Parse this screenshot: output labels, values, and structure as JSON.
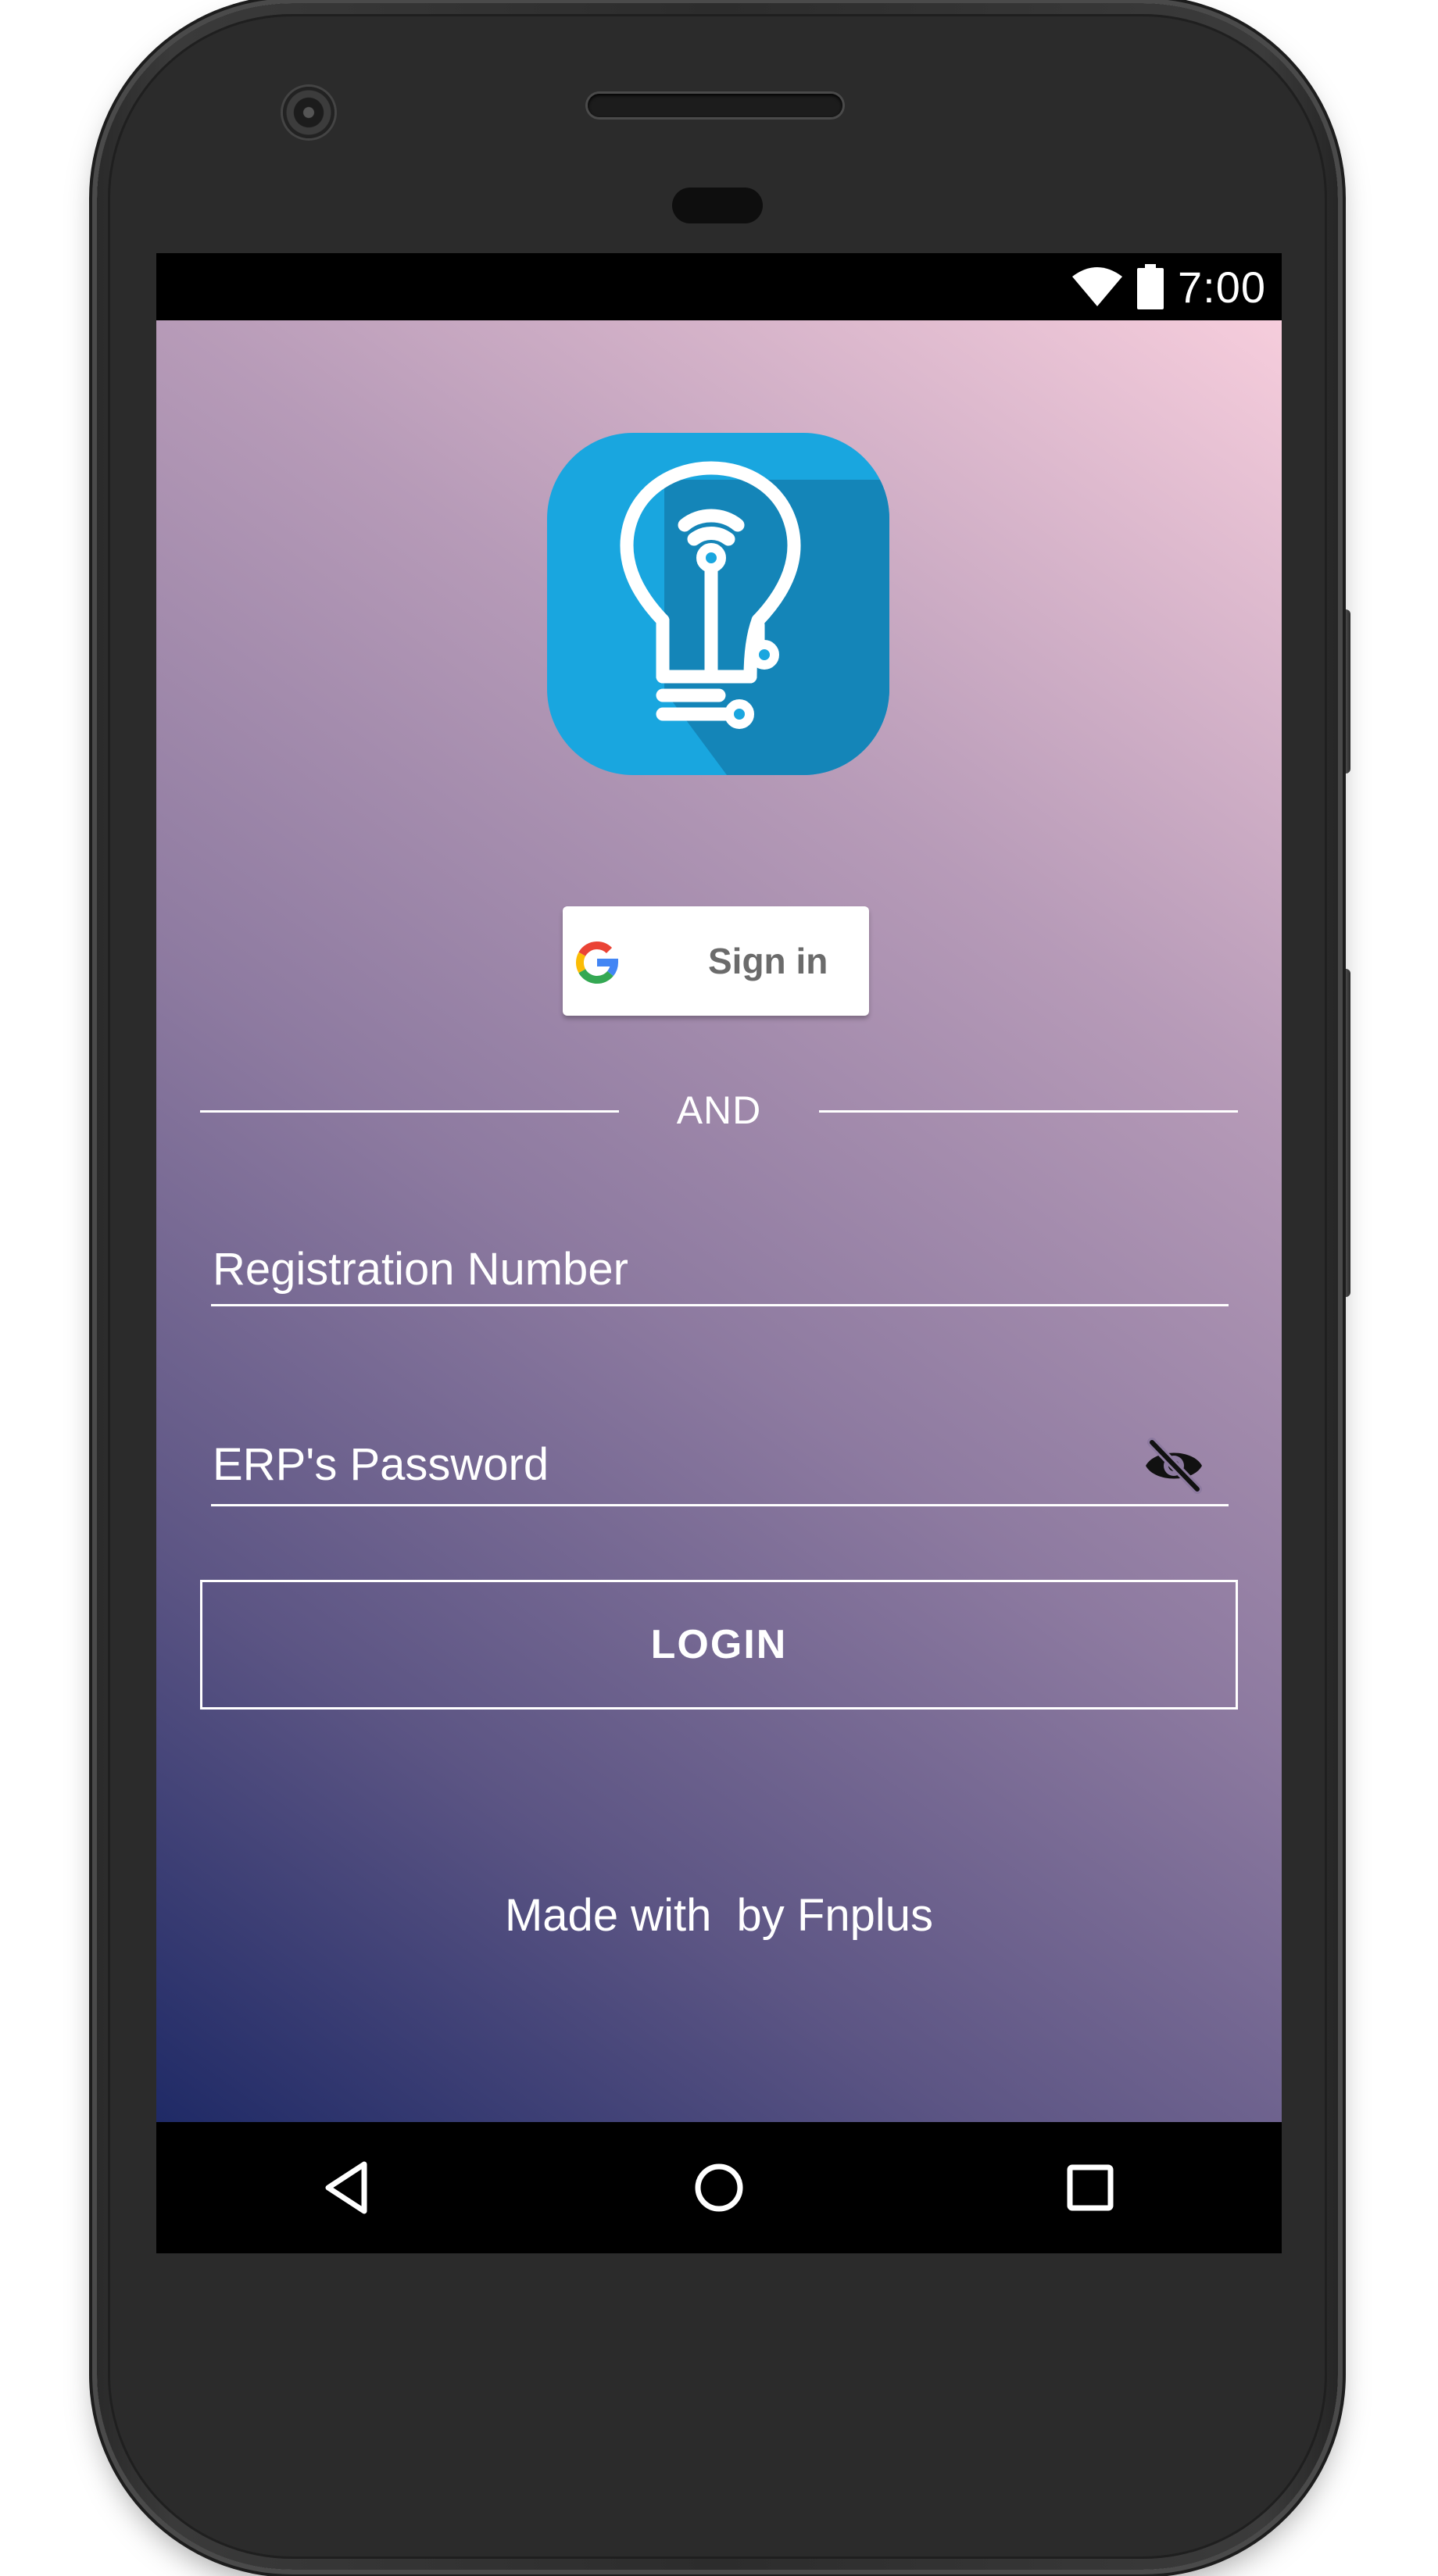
{
  "status_bar": {
    "time": "7:00",
    "icons": [
      "wifi-icon",
      "battery-icon"
    ]
  },
  "login_screen": {
    "logo_icon": "lightbulb-wifi-icon",
    "google_button": {
      "icon": "google-g-icon",
      "label": "Sign in"
    },
    "divider_text": "AND",
    "registration_field": {
      "placeholder": "Registration Number",
      "value": ""
    },
    "password_field": {
      "placeholder": "ERP's Password",
      "value": "",
      "toggle_icon": "eye-off-icon"
    },
    "login_button": {
      "label": "LOGIN"
    },
    "footer": "Made with  by Fnplus"
  },
  "nav_bar": {
    "buttons": [
      "back-icon",
      "home-icon",
      "recents-icon"
    ]
  },
  "colors": {
    "logo_blue": "#19a6df",
    "logo_shadow_blue": "#1485b8",
    "gradient_top": "#f6cddc",
    "gradient_bottom": "#1f2a66",
    "google_label": "#6b6b6b"
  }
}
